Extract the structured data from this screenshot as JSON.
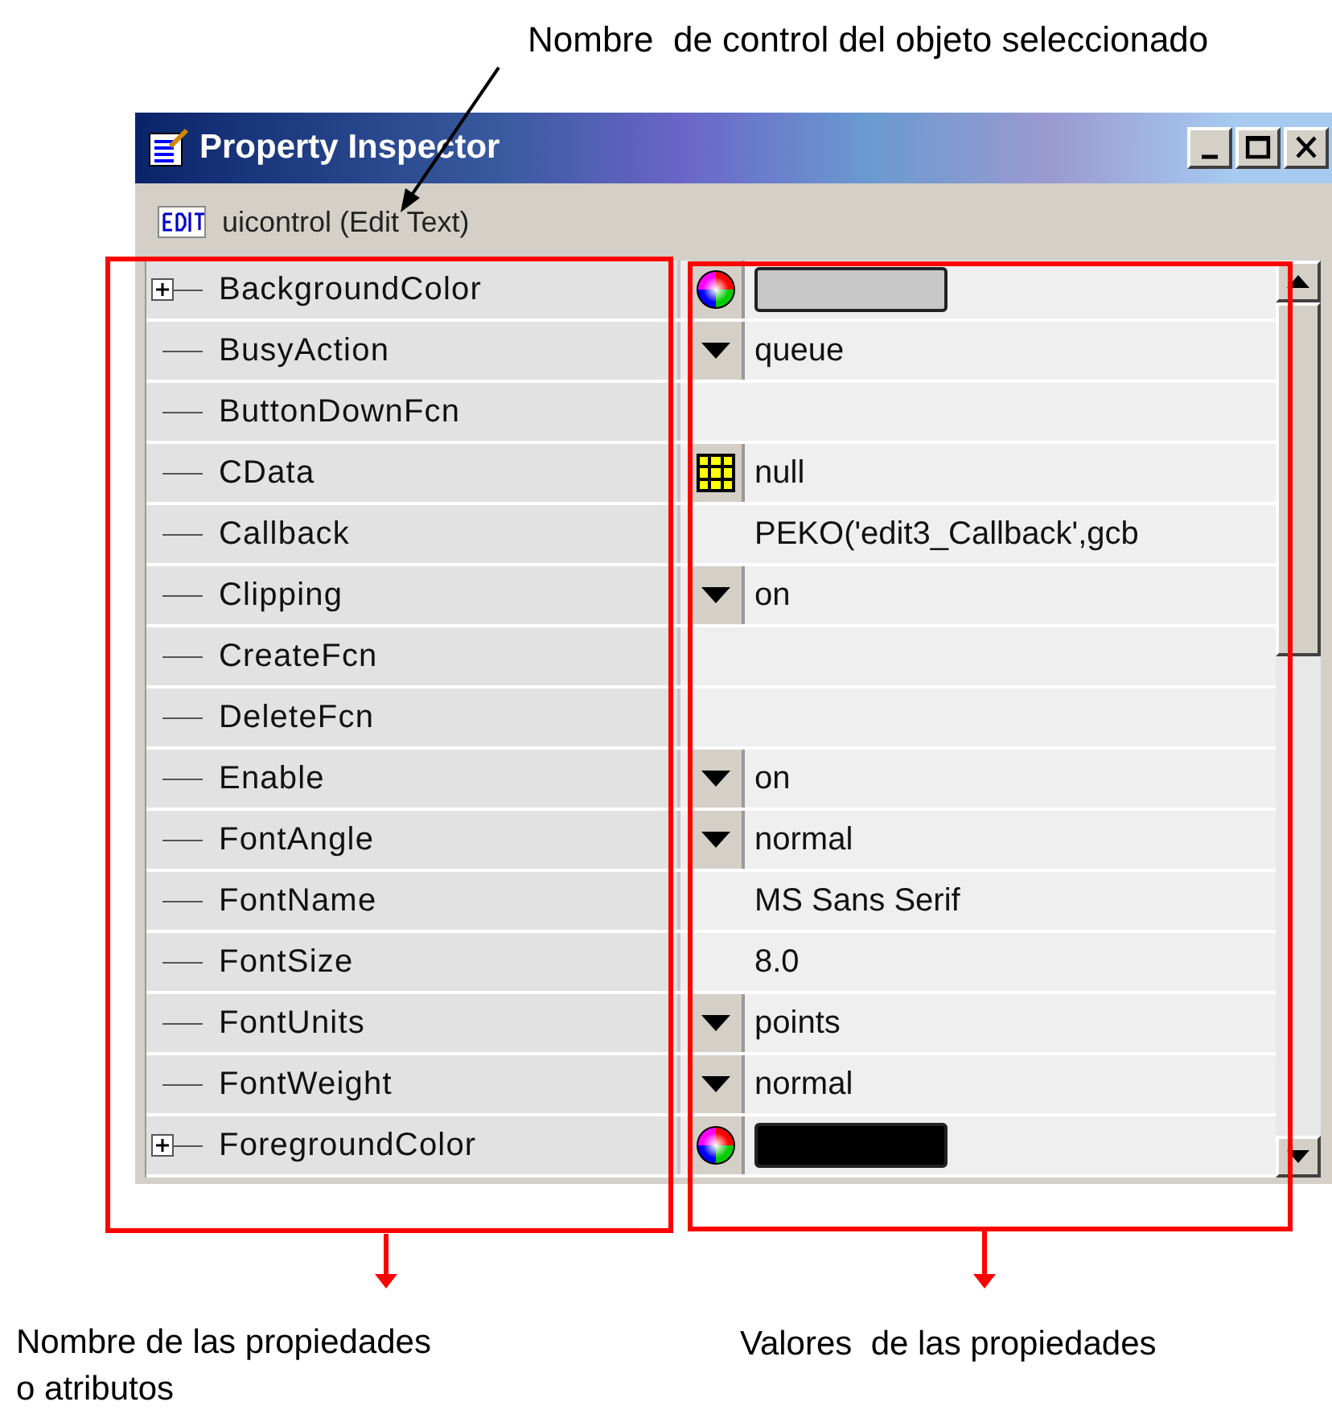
{
  "annotations": {
    "top_label": "Nombre  de control del objeto seleccionado",
    "left_label": "Nombre de las propiedades\no atributos",
    "right_label": "Valores  de las propiedades"
  },
  "window": {
    "title": "Property Inspector",
    "object": "uicontrol (Edit Text)"
  },
  "rows": [
    {
      "name": "BackgroundColor",
      "expandable": true,
      "kind": "color",
      "color": "#c8c8c8"
    },
    {
      "name": "BusyAction",
      "expandable": false,
      "kind": "enum",
      "value": "queue"
    },
    {
      "name": "ButtonDownFcn",
      "expandable": false,
      "kind": "empty"
    },
    {
      "name": "CData",
      "expandable": false,
      "kind": "matrix",
      "value": "null"
    },
    {
      "name": "Callback",
      "expandable": false,
      "kind": "text",
      "value": "PEKO('edit3_Callback',gcb"
    },
    {
      "name": "Clipping",
      "expandable": false,
      "kind": "enum",
      "value": "on"
    },
    {
      "name": "CreateFcn",
      "expandable": false,
      "kind": "empty"
    },
    {
      "name": "DeleteFcn",
      "expandable": false,
      "kind": "empty"
    },
    {
      "name": "Enable",
      "expandable": false,
      "kind": "enum",
      "value": "on"
    },
    {
      "name": "FontAngle",
      "expandable": false,
      "kind": "enum",
      "value": "normal"
    },
    {
      "name": "FontName",
      "expandable": false,
      "kind": "text",
      "value": "MS Sans Serif"
    },
    {
      "name": "FontSize",
      "expandable": false,
      "kind": "text",
      "value": "8.0"
    },
    {
      "name": "FontUnits",
      "expandable": false,
      "kind": "enum",
      "value": "points"
    },
    {
      "name": "FontWeight",
      "expandable": false,
      "kind": "enum",
      "value": "normal"
    },
    {
      "name": "ForegroundColor",
      "expandable": true,
      "kind": "color",
      "color": "#000000"
    }
  ]
}
